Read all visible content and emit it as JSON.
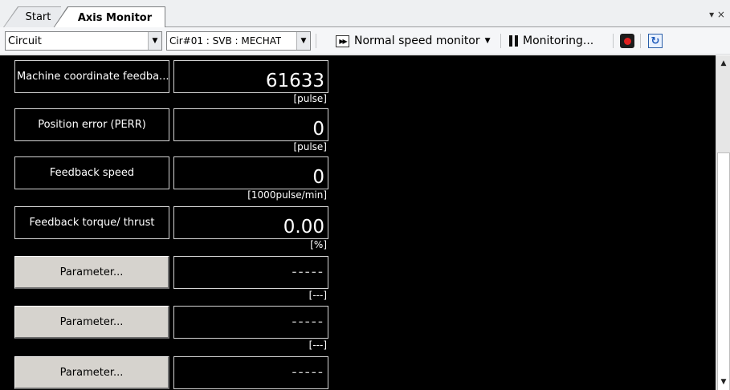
{
  "tabs": {
    "start_label": "Start",
    "active_label": "Axis Monitor",
    "menu_glyph": "≡ ×"
  },
  "toolbar": {
    "type_dropdown": "Circuit",
    "axis_dropdown": "Cir#01 : SVB : MECHAT",
    "speed_mode": "Normal speed monitor",
    "monitoring_label": "Monitoring...",
    "icons": [
      "fast-forward-icon",
      "pause-icon",
      "record-icon",
      "refresh-icon"
    ]
  },
  "monitor": {
    "rows": [
      {
        "label": "Machine coordinate feedba...",
        "value": "61633",
        "unit": "[pulse]"
      },
      {
        "label": "Position error (PERR)",
        "value": "0",
        "unit": "[pulse]"
      },
      {
        "label": "Feedback speed",
        "value": "0",
        "unit": "[1000pulse/min]"
      },
      {
        "label": "Feedback torque/ thrust",
        "value": "0.00",
        "unit": "[%]"
      },
      {
        "label": "Parameter...",
        "value": "-----",
        "unit": "[---]"
      },
      {
        "label": "Parameter...",
        "value": "-----",
        "unit": "[---]"
      },
      {
        "label": "Parameter...",
        "value": "-----",
        "unit": "[---]"
      }
    ]
  },
  "colors": {
    "panel_bg": "#000000",
    "param_button_bg": "#d6d3ce",
    "toolbar_bg": "#f5f6f8"
  }
}
